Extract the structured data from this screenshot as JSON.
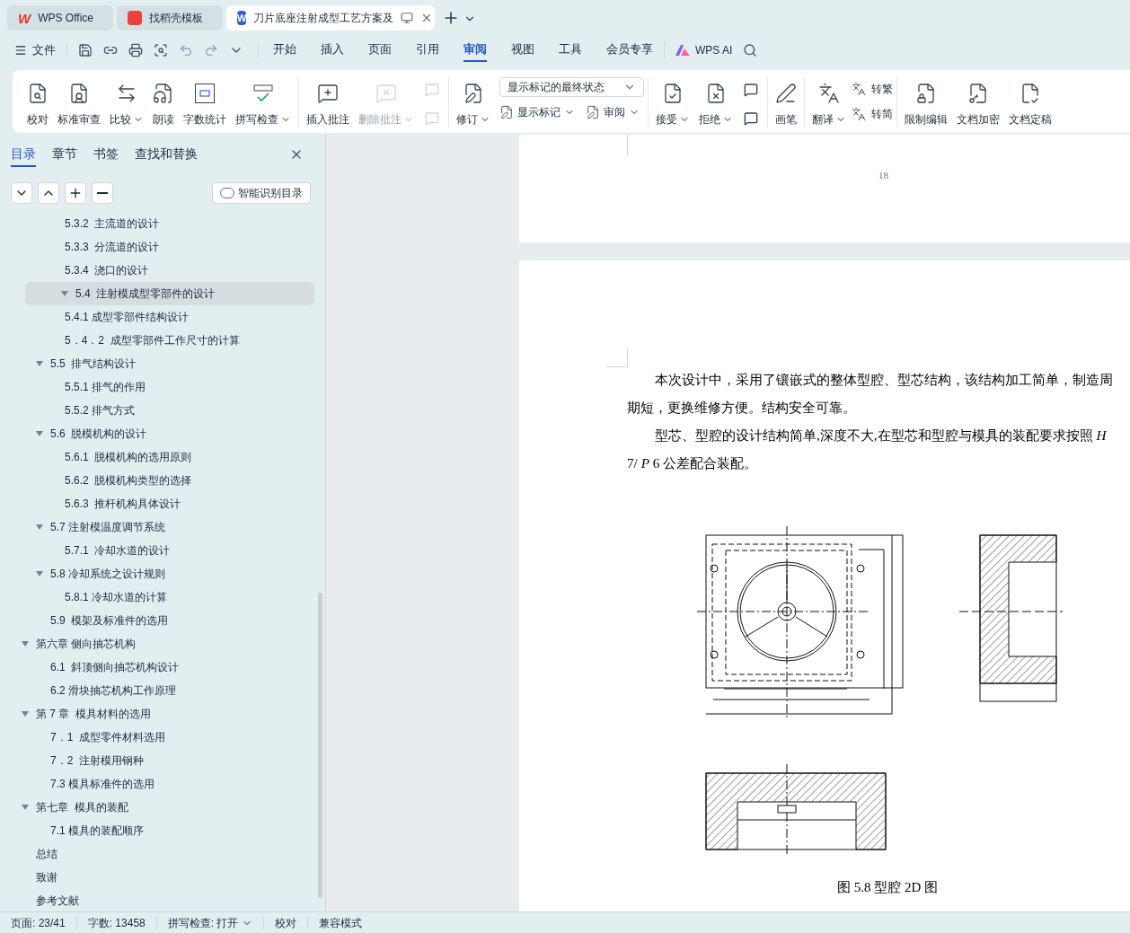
{
  "tabs": [
    {
      "label": "WPS Office",
      "kind": "home",
      "logo": "W",
      "selected": false
    },
    {
      "label": "找稻壳模板",
      "kind": "template",
      "selected": false
    },
    {
      "label": "刀片底座注射成型工艺方案及",
      "kind": "doc",
      "logo": "W",
      "selected": true
    }
  ],
  "menu": {
    "file": "文件",
    "tabs": [
      {
        "label": "开始",
        "selected": false
      },
      {
        "label": "插入",
        "selected": false
      },
      {
        "label": "页面",
        "selected": false
      },
      {
        "label": "引用",
        "selected": false
      },
      {
        "label": "审阅",
        "selected": true
      },
      {
        "label": "视图",
        "selected": false
      },
      {
        "label": "工具",
        "selected": false
      },
      {
        "label": "会员专享",
        "selected": false
      }
    ],
    "ai": "WPS AI"
  },
  "ribbon": {
    "groups": [
      {
        "items": [
          {
            "kind": "big",
            "label": "校对",
            "dropdown": false,
            "disabled": false
          },
          {
            "kind": "big",
            "label": "标准审查",
            "dropdown": false,
            "disabled": false
          },
          {
            "kind": "big",
            "label": "比较",
            "dropdown": true,
            "disabled": false
          },
          {
            "kind": "big",
            "label": "朗读",
            "dropdown": false,
            "disabled": false
          },
          {
            "kind": "big",
            "label": "字数统计",
            "dropdown": false,
            "disabled": false
          },
          {
            "kind": "big",
            "label": "拼写检查",
            "dropdown": true,
            "disabled": false
          }
        ]
      },
      {
        "items": [
          {
            "kind": "big",
            "label": "插入批注",
            "dropdown": false,
            "disabled": false
          },
          {
            "kind": "big",
            "label": "删除批注",
            "dropdown": true,
            "disabled": true
          },
          {
            "kind": "pair",
            "disabled": true
          }
        ]
      },
      {
        "items": [
          {
            "kind": "big",
            "label": "修订",
            "dropdown": true,
            "disabled": false
          },
          {
            "kind": "panel",
            "select": "显示标记的最终状态",
            "items": [
              {
                "label": "显示标记",
                "dropdown": true
              },
              {
                "label": "审阅",
                "dropdown": true
              }
            ]
          }
        ]
      },
      {
        "items": [
          {
            "kind": "big",
            "label": "接受",
            "dropdown": true,
            "disabled": false
          },
          {
            "kind": "big",
            "label": "拒绝",
            "dropdown": true,
            "disabled": false
          },
          {
            "kind": "pair",
            "disabled": false
          }
        ]
      },
      {
        "items": [
          {
            "kind": "big",
            "label": "画笔",
            "dropdown": false,
            "disabled": false
          }
        ]
      },
      {
        "items": [
          {
            "kind": "big",
            "label": "翻译",
            "dropdown": true,
            "disabled": false
          },
          {
            "kind": "stack",
            "items": [
              {
                "label": "转繁"
              },
              {
                "label": "转简"
              }
            ]
          }
        ]
      },
      {
        "items": [
          {
            "kind": "big",
            "label": "限制编辑",
            "dropdown": false,
            "disabled": false
          },
          {
            "kind": "big",
            "label": "文档加密",
            "dropdown": false,
            "disabled": false
          },
          {
            "kind": "big",
            "label": "文档定稿",
            "dropdown": false,
            "disabled": false
          }
        ]
      }
    ]
  },
  "sidebar": {
    "tabs": [
      {
        "label": "目录",
        "selected": true
      },
      {
        "label": "章节",
        "selected": false
      },
      {
        "label": "书签",
        "selected": false
      },
      {
        "label": "查找和替换",
        "selected": false
      }
    ],
    "smart_button": "智能识别目录",
    "toc": [
      {
        "children": [
          {
            "children": [
              {
                "label": "5.3.2  主流道的设计",
                "selected": false
              },
              {
                "label": "5.3.3  分流道的设计",
                "selected": false
              },
              {
                "label": "5.3.4  浇口的设计",
                "selected": false
              }
            ]
          },
          {
            "label": "5.4  注射模成型零部件的设计",
            "selected": true,
            "expanded": true,
            "children": [
              {
                "label": "5.4.1 成型零部件结构设计",
                "selected": false
              },
              {
                "label": "5．4．2  成型零部件工作尺寸的计算",
                "selected": false
              }
            ]
          },
          {
            "label": "5.5  排气结构设计",
            "selected": false,
            "expanded": true,
            "children": [
              {
                "label": "5.5.1 排气的作用",
                "selected": false
              },
              {
                "label": "5.5.2 排气方式",
                "selected": false
              }
            ]
          },
          {
            "label": "5.6  脱模机构的设计",
            "selected": false,
            "expanded": true,
            "children": [
              {
                "label": "5.6.1  脱模机构的选用原则",
                "selected": false
              },
              {
                "label": "5.6.2  脱模机构类型的选择",
                "selected": false
              },
              {
                "label": "5.6.3  推杆机构具体设计",
                "selected": false
              }
            ]
          },
          {
            "label": "5.7 注射模温度调节系统",
            "selected": false,
            "expanded": true,
            "children": [
              {
                "label": "5.7.1  冷却水道的设计",
                "selected": false
              }
            ]
          },
          {
            "label": "5.8 冷却系统之设计规则",
            "selected": false,
            "expanded": true,
            "children": [
              {
                "label": "5.8.1 冷却水道的计算",
                "selected": false
              }
            ]
          },
          {
            "label": "5.9  模架及标准件的选用",
            "selected": false
          }
        ]
      },
      {
        "label": "第六章 侧向抽芯机构",
        "selected": false,
        "expanded": true,
        "children": [
          {
            "label": "6.1  斜顶侧向抽芯机构设计",
            "selected": false
          },
          {
            "label": "6.2 滑块抽芯机构工作原理",
            "selected": false
          }
        ]
      },
      {
        "label": "第 7 章  模具材料的选用",
        "selected": false,
        "expanded": true,
        "children": [
          {
            "label": "7．1  成型零件材料选用",
            "selected": false
          },
          {
            "label": "7．2  注射模用钢种",
            "selected": false
          },
          {
            "label": "7.3 模具标准件的选用",
            "selected": false
          }
        ]
      },
      {
        "label": "第七章  模具的装配",
        "selected": false,
        "expanded": true,
        "children": [
          {
            "label": "7.1 模具的装配顺序",
            "selected": false
          }
        ]
      },
      {
        "label": "总结",
        "selected": false
      },
      {
        "label": "致谢",
        "selected": false
      },
      {
        "label": "参考文献",
        "selected": false
      }
    ]
  },
  "document": {
    "page_number": "18",
    "paragraphs": [
      "本次设计中，采用了镶嵌式的整体型腔、型芯结构，该结构加工简单，制造周期短，更换维修方便。结构安全可靠。",
      "型芯、型腔的设计结构简单,深度不大,在型芯和型腔与模具的装配要求按照 *H* 7/ *P* 6 公差配合装配。"
    ],
    "caption": "图 5.8 型腔 2D 图"
  },
  "status_bar": [
    {
      "label": "页面: 23/41",
      "dropdown": false
    },
    {
      "label": "字数: 13458",
      "dropdown": false
    },
    {
      "label": "拼写检查: 打开",
      "dropdown": true
    },
    {
      "label": "校对",
      "dropdown": false
    },
    {
      "label": "兼容模式",
      "dropdown": false
    }
  ]
}
